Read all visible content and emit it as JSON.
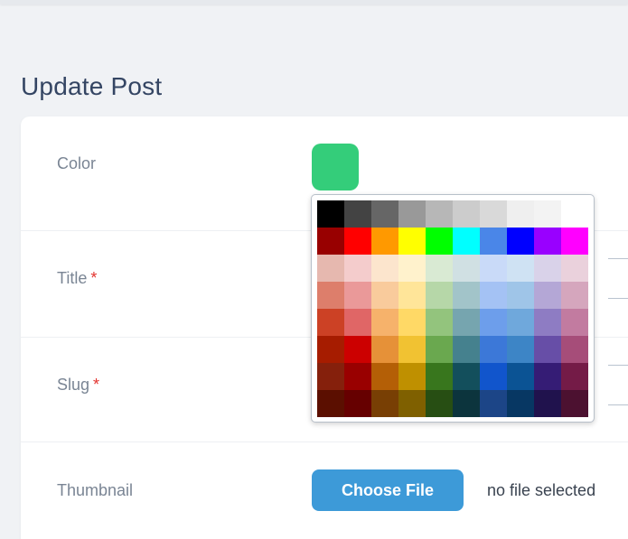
{
  "page": {
    "title": "Update Post"
  },
  "form": {
    "color": {
      "label": "Color",
      "value": "#34cd7a"
    },
    "title": {
      "label": "Title",
      "required_mark": "*"
    },
    "slug": {
      "label": "Slug",
      "required_mark": "*"
    },
    "thumbnail": {
      "label": "Thumbnail",
      "button_label": "Choose File",
      "status": "no file selected"
    }
  },
  "palette": {
    "rows": [
      [
        "#000000",
        "#434343",
        "#666666",
        "#999999",
        "#b7b7b7",
        "#cccccc",
        "#d9d9d9",
        "#efefef",
        "#f3f3f3",
        "#ffffff"
      ],
      [
        "#980000",
        "#ff0000",
        "#ff9900",
        "#ffff00",
        "#00ff00",
        "#00ffff",
        "#4a86e8",
        "#0000ff",
        "#9900ff",
        "#ff00ff"
      ],
      [
        "#e6b8af",
        "#f4cccc",
        "#fce5cd",
        "#fff2cc",
        "#d9ead3",
        "#d0e0e3",
        "#c9daf8",
        "#cfe2f3",
        "#d9d2e9",
        "#ead1dc"
      ],
      [
        "#dd7e6b",
        "#ea9999",
        "#f9cb9c",
        "#ffe599",
        "#b6d7a8",
        "#a2c4c9",
        "#a4c2f4",
        "#9fc5e8",
        "#b4a7d6",
        "#d5a6bd"
      ],
      [
        "#cc4125",
        "#e06666",
        "#f6b26b",
        "#ffd966",
        "#93c47d",
        "#76a5af",
        "#6d9eeb",
        "#6fa8dc",
        "#8e7cc3",
        "#c27ba0"
      ],
      [
        "#a61c00",
        "#cc0000",
        "#e69138",
        "#f1c232",
        "#6aa84f",
        "#45818e",
        "#3c78d8",
        "#3d85c6",
        "#674ea7",
        "#a64d79"
      ],
      [
        "#85200c",
        "#990000",
        "#b45f06",
        "#bf9000",
        "#38761d",
        "#134f5c",
        "#1155cc",
        "#0b5394",
        "#351c75",
        "#741b47"
      ],
      [
        "#5b0f00",
        "#660000",
        "#783f04",
        "#7f6000",
        "#274e13",
        "#0c343d",
        "#1c4587",
        "#073763",
        "#20124d",
        "#4c1130"
      ]
    ]
  }
}
